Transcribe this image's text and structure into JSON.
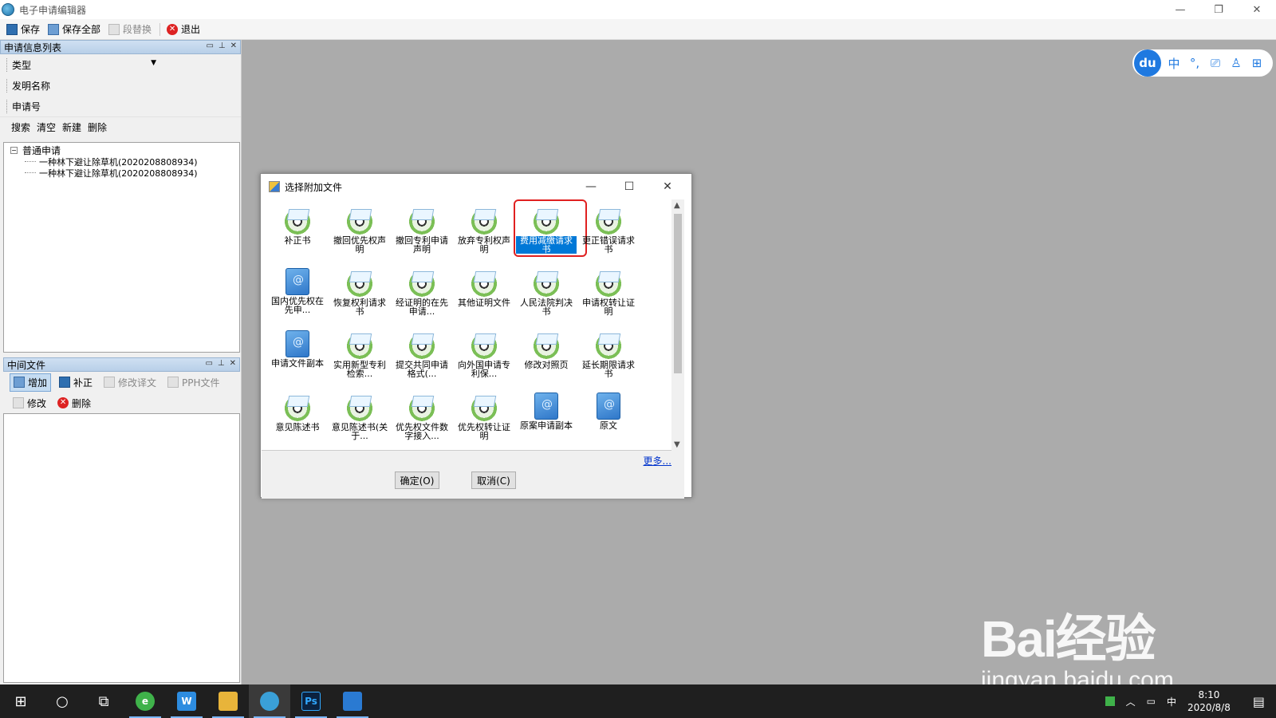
{
  "window": {
    "title": "电子申请编辑器"
  },
  "toolbar": {
    "save": "保存",
    "save_all": "保存全部",
    "replace": "段替换",
    "exit": "退出"
  },
  "app_list_panel": {
    "title": "申请信息列表",
    "type_label": "类型",
    "invention_label": "发明名称",
    "app_no_label": "申请号",
    "actions": [
      "搜索",
      "清空",
      "新建",
      "删除"
    ],
    "tree": {
      "root": "普通申请",
      "children": [
        "一种林下避让除草机(2020208808934)",
        "一种林下避让除草机(2020208808934)"
      ]
    }
  },
  "mid_panel": {
    "title": "中间文件",
    "row1": [
      "增加",
      "补正",
      "修改译文",
      "PPH文件"
    ],
    "row2": [
      "修改",
      "删除"
    ]
  },
  "dialog": {
    "title": "选择附加文件",
    "items": [
      {
        "label": "补正书",
        "icon": "disc"
      },
      {
        "label": "撤回优先权声明",
        "icon": "disc"
      },
      {
        "label": "撤回专利申请声明",
        "icon": "disc"
      },
      {
        "label": "放弃专利权声明",
        "icon": "disc"
      },
      {
        "label": "费用减缴请求书",
        "icon": "disc",
        "selected": true
      },
      {
        "label": "更正错误请求书",
        "icon": "disc"
      },
      {
        "label": "国内优先权在先申...",
        "icon": "book"
      },
      {
        "label": "恢复权利请求书",
        "icon": "disc"
      },
      {
        "label": "经证明的在先申请...",
        "icon": "disc"
      },
      {
        "label": "其他证明文件",
        "icon": "disc"
      },
      {
        "label": "人民法院判决书",
        "icon": "disc"
      },
      {
        "label": "申请权转让证明",
        "icon": "disc"
      },
      {
        "label": "申请文件副本",
        "icon": "book"
      },
      {
        "label": "实用新型专利检索...",
        "icon": "disc"
      },
      {
        "label": "提交共同申请格式(...",
        "icon": "disc"
      },
      {
        "label": "向外国申请专利保...",
        "icon": "disc"
      },
      {
        "label": "修改对照页",
        "icon": "disc"
      },
      {
        "label": "延长期限请求书",
        "icon": "disc"
      },
      {
        "label": "意见陈述书",
        "icon": "disc"
      },
      {
        "label": "意见陈述书(关于...",
        "icon": "disc"
      },
      {
        "label": "优先权文件数字接入...",
        "icon": "disc"
      },
      {
        "label": "优先权转让证明",
        "icon": "disc"
      },
      {
        "label": "原案申请副本",
        "icon": "book"
      },
      {
        "label": "原文",
        "icon": "book"
      }
    ],
    "more": "更多...",
    "ok": "确定(O)",
    "cancel": "取消(C)"
  },
  "baidu_bar": {
    "logo": "du",
    "items": [
      "中",
      "°,",
      "⎚",
      "♙",
      "⊞"
    ]
  },
  "watermark": {
    "main": "Bai经验",
    "sub": "jingyan.baidu.com"
  },
  "taskbar": {
    "time": "8:10",
    "date": "2020/8/8",
    "ime": "中"
  }
}
